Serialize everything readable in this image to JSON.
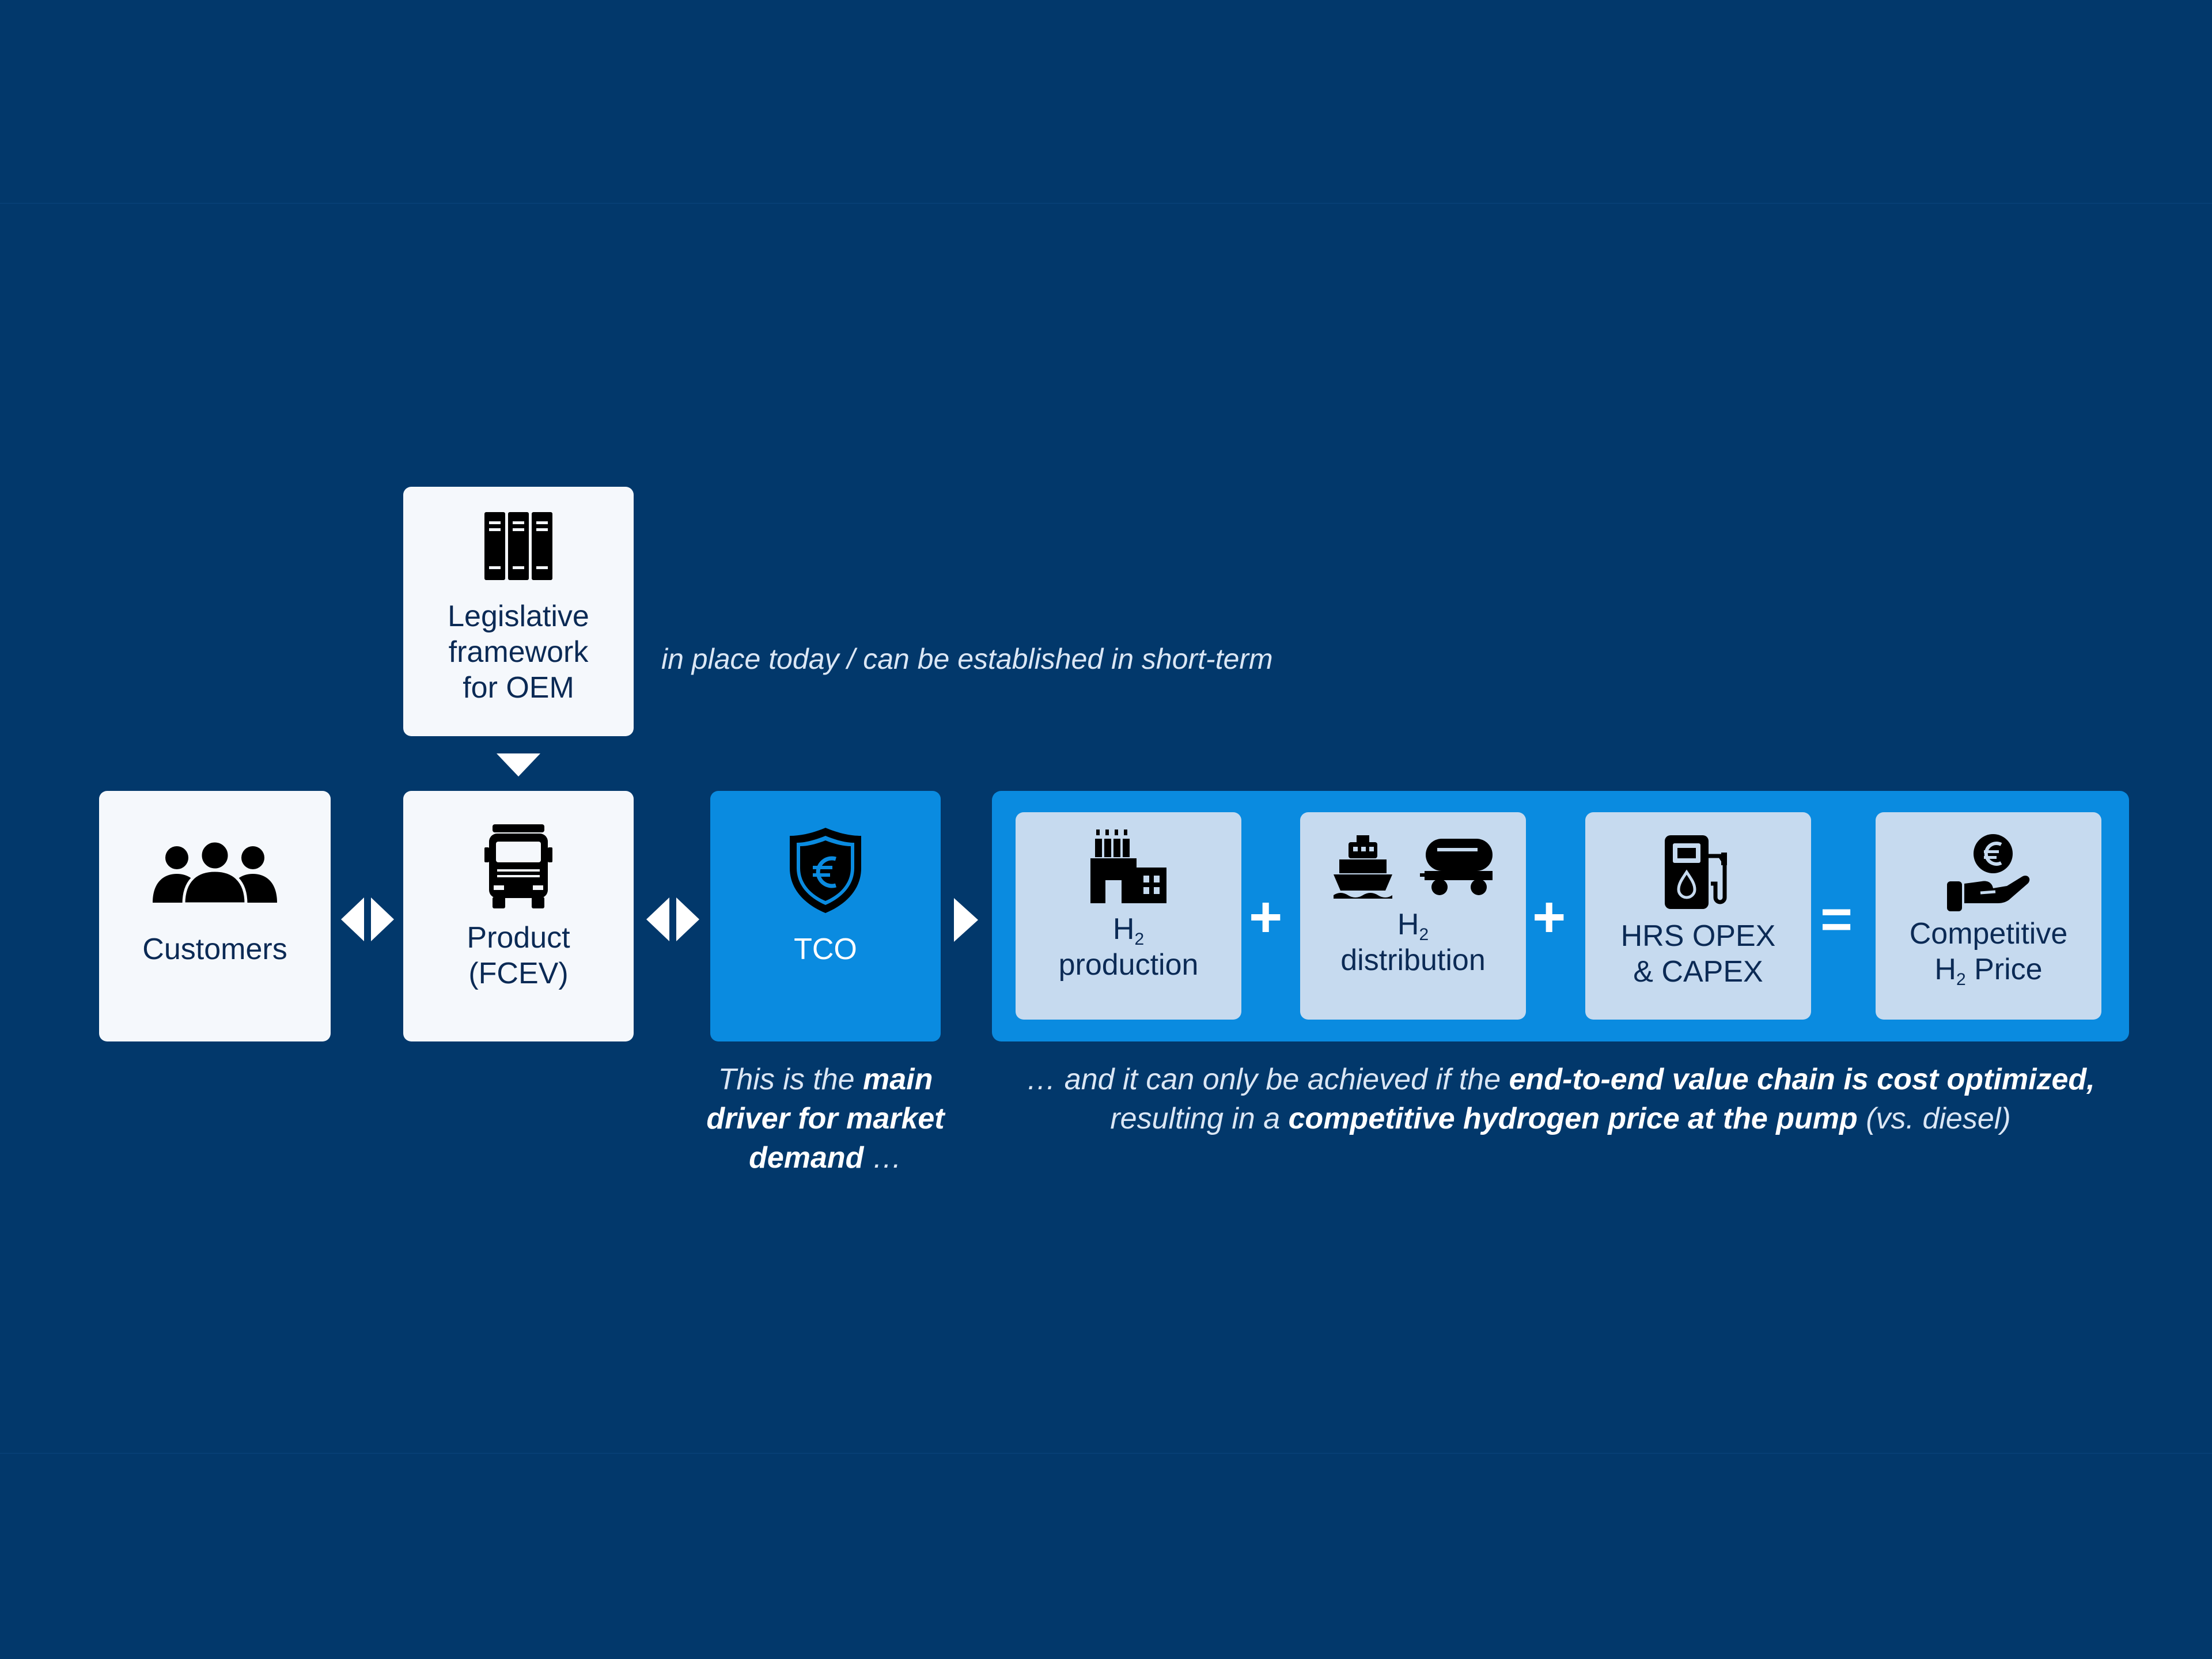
{
  "legislative": {
    "line1": "Legislative",
    "line2": "framework",
    "line3": "for OEM",
    "icon": "books-icon"
  },
  "top_note": "in place today / can be established in short-term",
  "customers": {
    "label": "Customers",
    "icon": "people-icon"
  },
  "product": {
    "line1": "Product",
    "line2": "(FCEV)",
    "icon": "truck-icon"
  },
  "tco": {
    "label": "TCO",
    "icon": "euro-shield-icon"
  },
  "chain": {
    "production": {
      "prefix": "H",
      "sub": "2",
      "line2": "production",
      "icon": "factory-icon"
    },
    "distribution": {
      "prefix": "H",
      "sub": "2",
      "line2": "distribution",
      "icon": "ship-tanker-icon"
    },
    "hrs": {
      "line1": "HRS OPEX",
      "line2": "& CAPEX",
      "icon": "fuel-pump-icon"
    },
    "price": {
      "line1": "Competitive",
      "prefix": "H",
      "sub": "2",
      "suffix": " Price",
      "icon": "hand-euro-icon"
    },
    "plus": "+",
    "equals": "="
  },
  "tco_note": {
    "t1": "This is the ",
    "b1": "main",
    "b2": "driver for market",
    "b3": "demand",
    "t2": " …"
  },
  "chain_note": {
    "t1": "… and it can only be achieved if the ",
    "b1": "end-to-end value chain is cost optimized,",
    "t2": "resulting in a ",
    "b2": "competitive hydrogen price at the pump",
    "t3": " (vs. diesel)"
  },
  "colors": {
    "background": "#02386b",
    "accent": "#0a8be0",
    "box": "#f5f8fc",
    "inner_box": "#c6daef",
    "text_dark": "#0b2a55"
  }
}
